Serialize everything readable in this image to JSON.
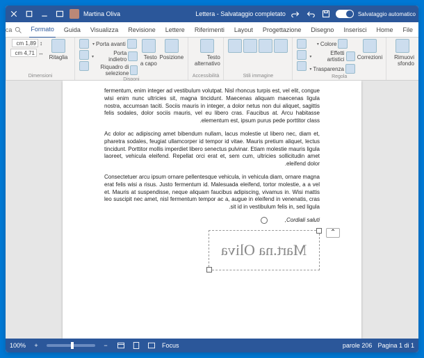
{
  "titlebar": {
    "autosave_label": "Salvataggio automatico",
    "doc_title": "Lettera - Salvataggio completato",
    "user_name": "Martina Oliva"
  },
  "tabs": {
    "file": "File",
    "home": "Home",
    "inserisci": "Inserisci",
    "disegno": "Disegno",
    "progettazione": "Progettazione",
    "layout": "Layout",
    "riferimenti": "Riferimenti",
    "lettere": "Lettere",
    "revisione": "Revisione",
    "visualizza": "Visualizza",
    "guida": "Guida",
    "formato": "Formato",
    "search": "Cerca"
  },
  "ribbon": {
    "rimuovi_sfondo": "Rimuovi sfondo",
    "correzioni": "Correzioni",
    "colore": "Colore",
    "effetti": "Effetti artistici",
    "trasparenza": "Trasparenza",
    "regola_label": "Regola",
    "stili_label": "Stili immagine",
    "testo_alt": "Testo alternativo",
    "access_label": "Accessibilità",
    "posizione": "Posizione",
    "testo_acapo": "Testo a capo",
    "porta_avanti": "Porta avanti",
    "porta_indietro": "Porta indietro",
    "riquadro": "Riquadro di selezione",
    "disponi_label": "Disponi",
    "ritaglia": "Ritaglia",
    "height_val": "1,89 cm",
    "width_val": "4,71 cm",
    "dim_label": "Dimensioni"
  },
  "document": {
    "para1": "fermentum, enim integer ad vestibulum volutpat. Nisl rhoncus turpis est, vel elit, congue wisi enim nunc ultricies sit, magna tincidunt. Maecenas aliquam maecenas ligula nostra, accumsan taciti. Sociis mauris in integer, a dolor netus non dui aliquet, sagittis felis sodales, dolor sociis mauris, vel eu libero cras. Faucibus at. Arcu habitasse elementum est, ipsum purus pede porttitor class.",
    "para2": "Ac dolor ac adipiscing amet bibendum nullam, lacus molestie ut libero nec, diam et, pharetra sodales, feugiat ullamcorper id tempor id vitae. Mauris pretium aliquet, lectus tincidunt. Porttitor mollis imperdiet libero senectus pulvinar. Etiam molestie mauris ligula laoreet, vehicula eleifend. Repellat orci erat et, sem cum, ultricies sollicitudin amet eleifend dolor.",
    "para3": "Consectetuer arcu ipsum ornare pellentesque vehicula, in vehicula diam, ornare magna erat felis wisi a risus. Justo fermentum id. Malesuada eleifend, tortor molestie, a a vel et. Mauris at suspendisse, neque aliquam faucibus adipiscing, vivamus in. Wisi mattis leo suscipit nec amet, nisl fermentum tempor ac a, augue in eleifend in venenatis, cras sit id in vestibulum felis in, sed ligula.",
    "closing": "Cordiali saluti,",
    "signature_text": "Mart.na Oliva"
  },
  "statusbar": {
    "page_info": "Pagina 1 di 1",
    "word_count": "206 parole",
    "focus": "Focus",
    "zoom": "100%"
  }
}
